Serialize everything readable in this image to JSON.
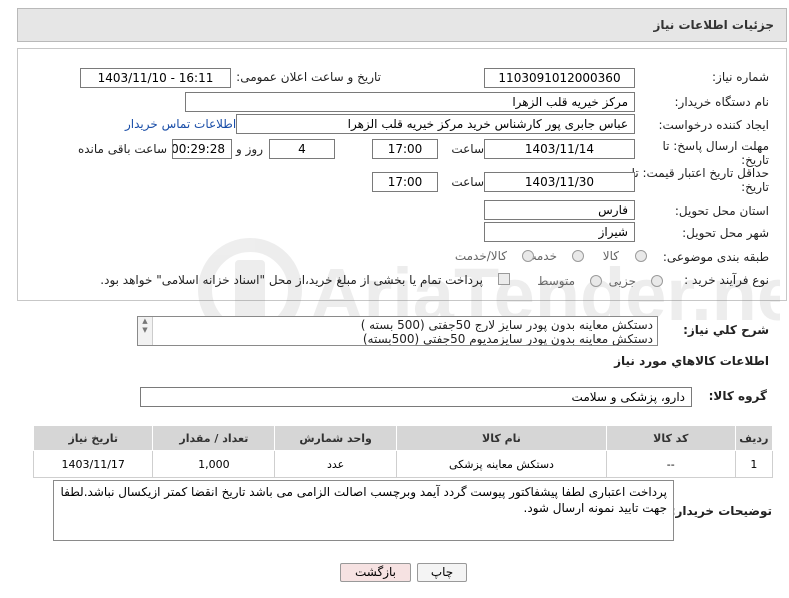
{
  "header": {
    "title": "جزئیات اطلاعات نیاز"
  },
  "form": {
    "need_number_label": "شماره نیاز:",
    "need_number": "1103091012000360",
    "announce_label": "تاریخ و ساعت اعلان عمومی:",
    "announce_value": "1403/11/10 - 16:11",
    "buyer_org_label": "نام دستگاه خریدار:",
    "buyer_org": "مرکز خیریه قلب الزهرا",
    "creator_label": "ایجاد کننده درخواست:",
    "creator": "عباس جابری پور کارشناس خرید مرکز خیریه قلب الزهرا",
    "contact_link": "اطلاعات تماس خریدار",
    "deadline_label_1": "مهلت ارسال پاسخ: تا",
    "deadline_label_2": "تاریخ:",
    "deadline_date": "1403/11/14",
    "time_label": "ساعت",
    "deadline_time": "17:00",
    "days_value": "4",
    "days_label": "روز و",
    "remaining_time": "00:29:28",
    "remaining_label": "ساعت باقی مانده",
    "validity_label_1": "حداقل تاریخ اعتبار قیمت: تا",
    "validity_label_2": "تاریخ:",
    "validity_date": "1403/11/30",
    "validity_time": "17:00",
    "province_label": "استان محل تحویل:",
    "province": "فارس",
    "city_label": "شهر محل تحویل:",
    "city": "شیراز",
    "category_label": "طبقه بندی موضوعی:",
    "category_options": [
      "کالا",
      "خدمت",
      "کالا/خدمت"
    ],
    "process_label": "نوع فرآیند خرید :",
    "process_options": [
      "جزیی",
      "متوسط"
    ],
    "payment_text": "پرداخت تمام یا بخشی از مبلغ خرید،از محل \"اسناد خزانه اسلامی\" خواهد بود."
  },
  "summary": {
    "label": "شرح کلي نياز:",
    "line1": "دستکش معاینه بدون پودر سایز لارج 50جفتی  (500 بسته )",
    "line2": "دستکش معاینه بدون پودر سایزمدیوم 50جفتی   (500بسته)"
  },
  "goods": {
    "section_title": "اطلاعات کالاهاي مورد نياز",
    "group_label": "گروه کالا:",
    "group_value": "دارو، پزشکی و سلامت",
    "columns": [
      "ردیف",
      "کد کالا",
      "نام کالا",
      "واحد شمارش",
      "تعداد / مقدار",
      "تاریخ نیاز"
    ],
    "rows": [
      {
        "index": "1",
        "code": "--",
        "name": "دستکش معاینه پزشکی",
        "unit": "عدد",
        "qty": "1,000",
        "date": "1403/11/17"
      }
    ]
  },
  "buyer_notes": {
    "label": "توضیحات خریدار:",
    "text": "پرداخت اعتباری لطفا پیشفاکتور پیوست گردد آیمد وبرچسب اصالت الزامی می باشد تاریخ انقضا کمتر ازیکسال نباشد.لطفا جهت تایید نمونه ارسال شود."
  },
  "buttons": {
    "print": "چاپ",
    "back": "بازگشت"
  },
  "watermark": {
    "text": "AriaTender.neT"
  },
  "colors": {
    "panel_bg": "#e6e6e6",
    "link": "#1a4ea8",
    "back_button": "#f6e2e2",
    "table_header": "#d6d6d6"
  }
}
